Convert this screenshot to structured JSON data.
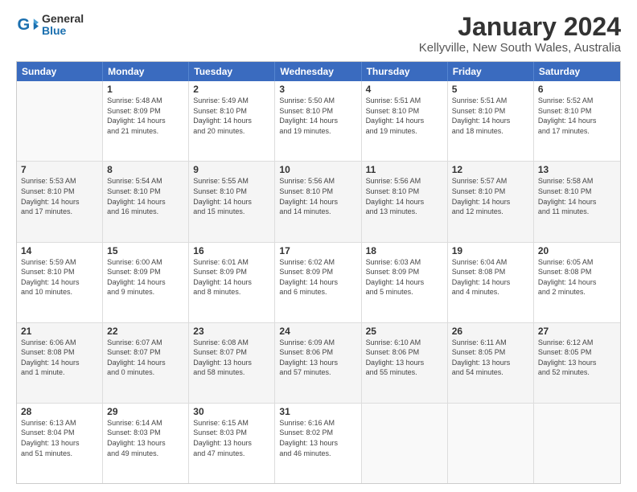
{
  "logo": {
    "text_general": "General",
    "text_blue": "Blue"
  },
  "title": "January 2024",
  "subtitle": "Kellyville, New South Wales, Australia",
  "days_of_week": [
    "Sunday",
    "Monday",
    "Tuesday",
    "Wednesday",
    "Thursday",
    "Friday",
    "Saturday"
  ],
  "weeks": [
    [
      {
        "day": "",
        "info": ""
      },
      {
        "day": "1",
        "info": "Sunrise: 5:48 AM\nSunset: 8:09 PM\nDaylight: 14 hours\nand 21 minutes."
      },
      {
        "day": "2",
        "info": "Sunrise: 5:49 AM\nSunset: 8:10 PM\nDaylight: 14 hours\nand 20 minutes."
      },
      {
        "day": "3",
        "info": "Sunrise: 5:50 AM\nSunset: 8:10 PM\nDaylight: 14 hours\nand 19 minutes."
      },
      {
        "day": "4",
        "info": "Sunrise: 5:51 AM\nSunset: 8:10 PM\nDaylight: 14 hours\nand 19 minutes."
      },
      {
        "day": "5",
        "info": "Sunrise: 5:51 AM\nSunset: 8:10 PM\nDaylight: 14 hours\nand 18 minutes."
      },
      {
        "day": "6",
        "info": "Sunrise: 5:52 AM\nSunset: 8:10 PM\nDaylight: 14 hours\nand 17 minutes."
      }
    ],
    [
      {
        "day": "7",
        "info": "Sunrise: 5:53 AM\nSunset: 8:10 PM\nDaylight: 14 hours\nand 17 minutes."
      },
      {
        "day": "8",
        "info": "Sunrise: 5:54 AM\nSunset: 8:10 PM\nDaylight: 14 hours\nand 16 minutes."
      },
      {
        "day": "9",
        "info": "Sunrise: 5:55 AM\nSunset: 8:10 PM\nDaylight: 14 hours\nand 15 minutes."
      },
      {
        "day": "10",
        "info": "Sunrise: 5:56 AM\nSunset: 8:10 PM\nDaylight: 14 hours\nand 14 minutes."
      },
      {
        "day": "11",
        "info": "Sunrise: 5:56 AM\nSunset: 8:10 PM\nDaylight: 14 hours\nand 13 minutes."
      },
      {
        "day": "12",
        "info": "Sunrise: 5:57 AM\nSunset: 8:10 PM\nDaylight: 14 hours\nand 12 minutes."
      },
      {
        "day": "13",
        "info": "Sunrise: 5:58 AM\nSunset: 8:10 PM\nDaylight: 14 hours\nand 11 minutes."
      }
    ],
    [
      {
        "day": "14",
        "info": "Sunrise: 5:59 AM\nSunset: 8:10 PM\nDaylight: 14 hours\nand 10 minutes."
      },
      {
        "day": "15",
        "info": "Sunrise: 6:00 AM\nSunset: 8:09 PM\nDaylight: 14 hours\nand 9 minutes."
      },
      {
        "day": "16",
        "info": "Sunrise: 6:01 AM\nSunset: 8:09 PM\nDaylight: 14 hours\nand 8 minutes."
      },
      {
        "day": "17",
        "info": "Sunrise: 6:02 AM\nSunset: 8:09 PM\nDaylight: 14 hours\nand 6 minutes."
      },
      {
        "day": "18",
        "info": "Sunrise: 6:03 AM\nSunset: 8:09 PM\nDaylight: 14 hours\nand 5 minutes."
      },
      {
        "day": "19",
        "info": "Sunrise: 6:04 AM\nSunset: 8:08 PM\nDaylight: 14 hours\nand 4 minutes."
      },
      {
        "day": "20",
        "info": "Sunrise: 6:05 AM\nSunset: 8:08 PM\nDaylight: 14 hours\nand 2 minutes."
      }
    ],
    [
      {
        "day": "21",
        "info": "Sunrise: 6:06 AM\nSunset: 8:08 PM\nDaylight: 14 hours\nand 1 minute."
      },
      {
        "day": "22",
        "info": "Sunrise: 6:07 AM\nSunset: 8:07 PM\nDaylight: 14 hours\nand 0 minutes."
      },
      {
        "day": "23",
        "info": "Sunrise: 6:08 AM\nSunset: 8:07 PM\nDaylight: 13 hours\nand 58 minutes."
      },
      {
        "day": "24",
        "info": "Sunrise: 6:09 AM\nSunset: 8:06 PM\nDaylight: 13 hours\nand 57 minutes."
      },
      {
        "day": "25",
        "info": "Sunrise: 6:10 AM\nSunset: 8:06 PM\nDaylight: 13 hours\nand 55 minutes."
      },
      {
        "day": "26",
        "info": "Sunrise: 6:11 AM\nSunset: 8:05 PM\nDaylight: 13 hours\nand 54 minutes."
      },
      {
        "day": "27",
        "info": "Sunrise: 6:12 AM\nSunset: 8:05 PM\nDaylight: 13 hours\nand 52 minutes."
      }
    ],
    [
      {
        "day": "28",
        "info": "Sunrise: 6:13 AM\nSunset: 8:04 PM\nDaylight: 13 hours\nand 51 minutes."
      },
      {
        "day": "29",
        "info": "Sunrise: 6:14 AM\nSunset: 8:03 PM\nDaylight: 13 hours\nand 49 minutes."
      },
      {
        "day": "30",
        "info": "Sunrise: 6:15 AM\nSunset: 8:03 PM\nDaylight: 13 hours\nand 47 minutes."
      },
      {
        "day": "31",
        "info": "Sunrise: 6:16 AM\nSunset: 8:02 PM\nDaylight: 13 hours\nand 46 minutes."
      },
      {
        "day": "",
        "info": ""
      },
      {
        "day": "",
        "info": ""
      },
      {
        "day": "",
        "info": ""
      }
    ]
  ]
}
